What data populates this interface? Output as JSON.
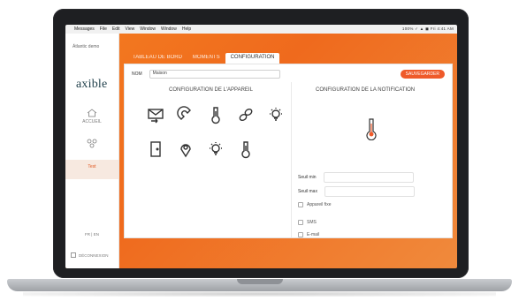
{
  "menubar": {
    "app_name": "Messages",
    "items": [
      "File",
      "Edit",
      "View",
      "Window",
      "Window",
      "Help"
    ],
    "status": "100% ✓ ▲ ◼ Fri 4:41 AM"
  },
  "sidebar": {
    "brand_small": "Átlantic demo",
    "logo_text": "axible",
    "items": [
      {
        "label": "ACCUEIL",
        "icon": "home-icon"
      },
      {
        "label": "",
        "icon": "network-icon"
      },
      {
        "label": "Test",
        "icon": "bell-icon",
        "active": true
      }
    ],
    "lang": "FR | EN",
    "logout": "DÉCONNEXION"
  },
  "tabs": [
    {
      "label": "TABLEAU DE BORD"
    },
    {
      "label": "MOMENTS"
    },
    {
      "label": "CONFIGURATION",
      "active": true
    }
  ],
  "panel": {
    "nom_label": "NOM",
    "nom_value": "Maison",
    "save_label": "SAUVEGARDER",
    "left_title": "CONFIGURATION DE L'APPAREIL",
    "right_title": "CONFIGURATION DE LA NOTIFICATION",
    "device_icons_row1": [
      "mail-icon",
      "magnet-icon",
      "thermometer-icon",
      "link-icon",
      "bulb-icon"
    ],
    "device_icons_row2": [
      "door-icon",
      "location-icon",
      "bulb-icon",
      "thermometer-icon"
    ],
    "seuil_min": "Seuil min",
    "seuil_max": "Seuil max",
    "options": [
      "Appareil fixe",
      "SMS",
      "E-mail"
    ]
  },
  "colors": {
    "accent": "#ef5a2a",
    "sidebar_bg": "#ffffff",
    "gradient_start": "#f47b20"
  }
}
